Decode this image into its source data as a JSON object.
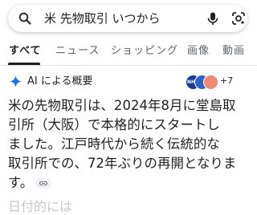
{
  "search": {
    "query": "米 先物取引 いつから",
    "icons": [
      "search-icon",
      "microphone-icon",
      "google-lens-icon"
    ]
  },
  "tabs": [
    {
      "label": "すべて",
      "active": true
    },
    {
      "label": "ニュース",
      "active": false
    },
    {
      "label": "ショッピング",
      "active": false
    },
    {
      "label": "画像",
      "active": false
    },
    {
      "label": "動画",
      "active": false
    }
  ],
  "ai_overview": {
    "title": "AI による概要",
    "source_count": "+7",
    "source_icons": [
      {
        "label": "NHK"
      },
      {
        "label": ""
      },
      {
        "label": ""
      }
    ],
    "lines": [
      "米の先物取引は、2024年8月に堂島取",
      "引所（大阪）で本格的にスタートし",
      "ました。江戸時代から続く伝統的な",
      "取引所での、72年ぶりの再開となりま",
      "す。"
    ],
    "link_icon": "link-icon"
  },
  "next_section_partial": "日付的には",
  "colors": {
    "accent_blue": "#1a73e8",
    "text": "#1f1f1f",
    "muted": "#5f6368"
  }
}
